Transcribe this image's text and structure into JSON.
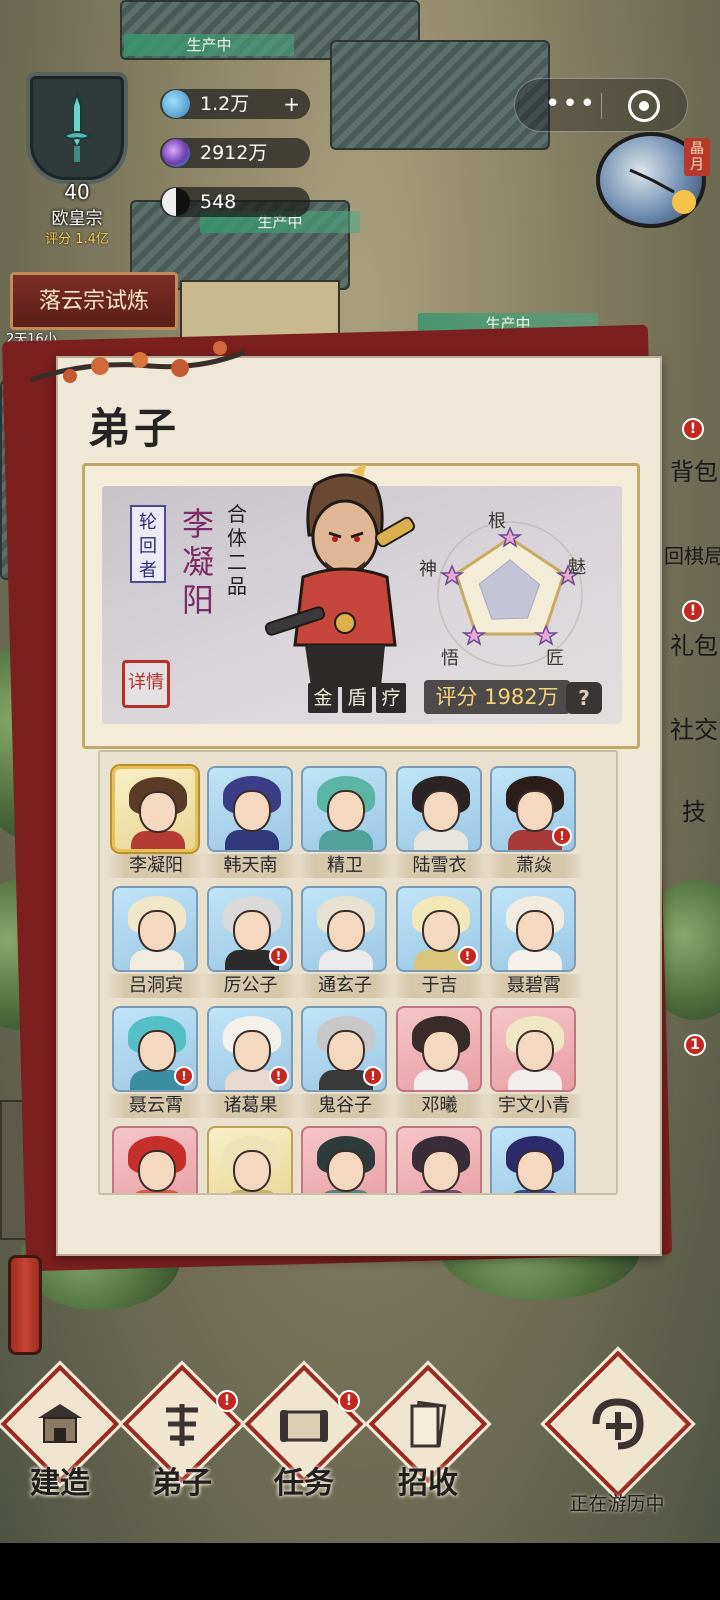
{
  "production_bars": [
    "生产中",
    "生产中",
    "生产中"
  ],
  "sect": {
    "level": "40",
    "name": "欧皇宗",
    "score": "评分 1.4亿"
  },
  "resources": {
    "spirit_stone": "1.2万",
    "gem": "2912万",
    "taiji": "548"
  },
  "event": {
    "title": "落云宗试炼",
    "time": "2天16小"
  },
  "clock_label": "晶月",
  "side_menu": [
    "背包",
    "回棋局",
    "礼包",
    "社交",
    "技"
  ],
  "panel": {
    "title": "弟子"
  },
  "hero": {
    "rank": "轮回者",
    "name": "李凝阳",
    "realm": "合体二品",
    "detail": "详情",
    "elements": [
      "金",
      "盾",
      "疗"
    ],
    "score": "评分 1982万",
    "help": "?",
    "radar_labels": {
      "top": "根",
      "right": "魅",
      "bottom_right": "匠",
      "bottom_left": "悟",
      "left": "神"
    },
    "radar_values": [
      0.55,
      0.5,
      0.48,
      0.5,
      0.52
    ]
  },
  "disciples": [
    {
      "name": "李凝阳",
      "bg": "gold",
      "selected": true,
      "alert": false
    },
    {
      "name": "韩天南",
      "bg": "blue",
      "selected": false,
      "alert": false
    },
    {
      "name": "精卫",
      "bg": "blue",
      "selected": false,
      "alert": false
    },
    {
      "name": "陆雪衣",
      "bg": "blue",
      "selected": false,
      "alert": false
    },
    {
      "name": "萧焱",
      "bg": "blue",
      "selected": false,
      "alert": true
    },
    {
      "name": "吕洞宾",
      "bg": "blue",
      "selected": false,
      "alert": false
    },
    {
      "name": "厉公子",
      "bg": "blue",
      "selected": false,
      "alert": true
    },
    {
      "name": "通玄子",
      "bg": "blue",
      "selected": false,
      "alert": false
    },
    {
      "name": "于吉",
      "bg": "blue",
      "selected": false,
      "alert": true
    },
    {
      "name": "聂碧霄",
      "bg": "blue",
      "selected": false,
      "alert": false
    },
    {
      "name": "聂云霄",
      "bg": "blue",
      "selected": false,
      "alert": true
    },
    {
      "name": "诸葛果",
      "bg": "blue",
      "selected": false,
      "alert": true
    },
    {
      "name": "鬼谷子",
      "bg": "blue",
      "selected": false,
      "alert": true
    },
    {
      "name": "邓曦",
      "bg": "pink",
      "selected": false,
      "alert": false
    },
    {
      "name": "宇文小青",
      "bg": "pink",
      "selected": false,
      "alert": false
    },
    {
      "name": "",
      "bg": "pink",
      "selected": false,
      "alert": false
    },
    {
      "name": "",
      "bg": "gold",
      "selected": false,
      "alert": false
    },
    {
      "name": "",
      "bg": "pink",
      "selected": false,
      "alert": false
    },
    {
      "name": "",
      "bg": "pink",
      "selected": false,
      "alert": false
    },
    {
      "name": "",
      "bg": "blue",
      "selected": false,
      "alert": false
    }
  ],
  "bottom_nav": [
    {
      "label": "建造",
      "alert": false
    },
    {
      "label": "弟子",
      "alert": true
    },
    {
      "label": "任务",
      "alert": true
    },
    {
      "label": "招收",
      "alert": false
    }
  ],
  "travel_label": "正在游历中",
  "badges": {
    "exclaim": "!",
    "count": "1"
  },
  "colors": {
    "accent_red": "#9a2a22",
    "panel_bg": "#efe8d6",
    "score_gold": "#f5d27a",
    "name_purple": "#7b2c66"
  }
}
